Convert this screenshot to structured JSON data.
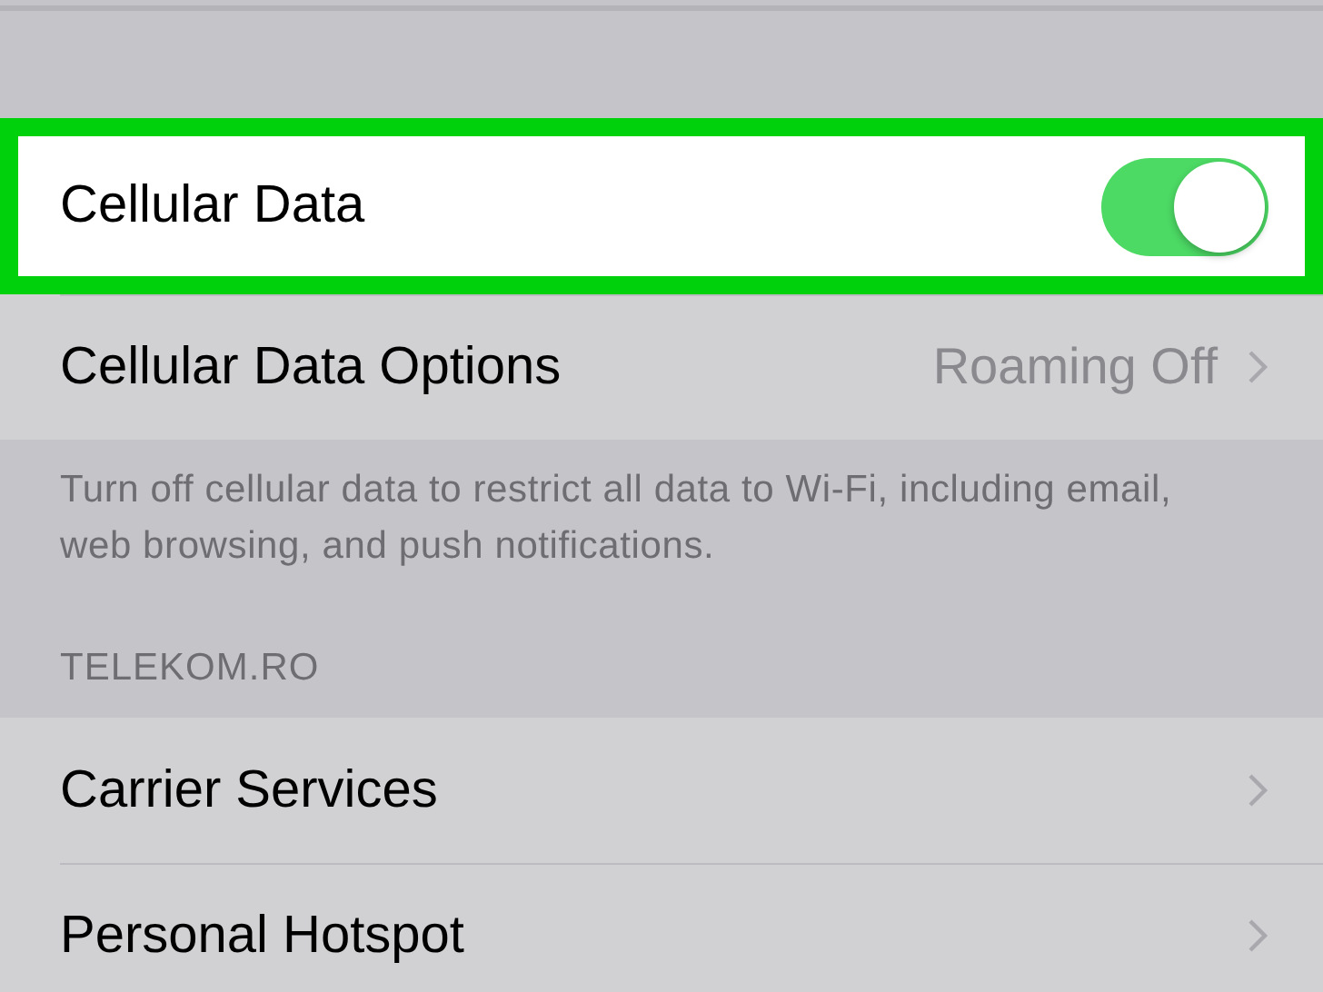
{
  "groups": [
    {
      "rows": [
        {
          "kind": "switch",
          "label": "Cellular Data",
          "on": true,
          "highlighted": true
        },
        {
          "kind": "link",
          "label": "Cellular Data Options",
          "value": "Roaming Off",
          "highlighted": false
        }
      ],
      "footer": "Turn off cellular data to restrict all data to Wi-Fi, including email, web browsing, and push notifications."
    },
    {
      "header": "TELEKOM.RO",
      "rows": [
        {
          "kind": "link",
          "label": "Carrier Services",
          "highlighted": false
        },
        {
          "kind": "link",
          "label": "Personal Hotspot",
          "highlighted": false
        }
      ]
    }
  ]
}
